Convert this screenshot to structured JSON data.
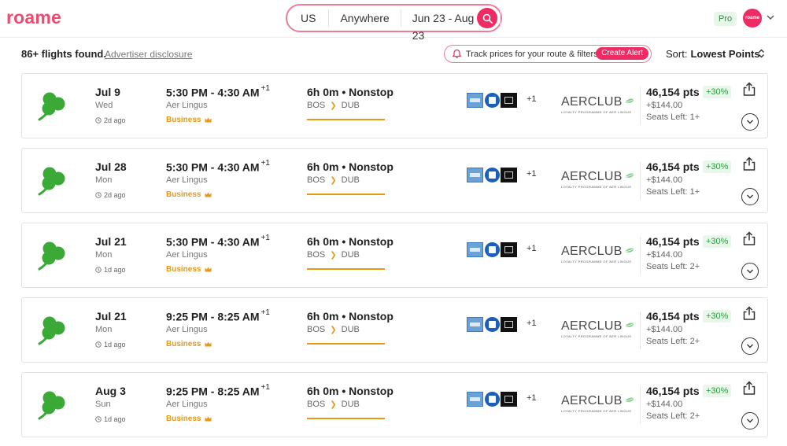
{
  "header": {
    "logo": "roame",
    "search": {
      "country": "US",
      "destination": "Anywhere",
      "dates": "Jun 23 - Aug 23"
    },
    "pro_label": "Pro",
    "avatar_label": "roame"
  },
  "subbar": {
    "found": "86+ flights found.",
    "disclosure": "Advertiser disclosure",
    "track_label": "Track prices for your route & filters",
    "create_alert": "Create Alert",
    "sort_label": "Sort:",
    "sort_value": "Lowest Points"
  },
  "colors": {
    "brand": "#ef2b63",
    "accent_orange": "#e59a1a",
    "clover_green": "#3aa935",
    "positive_green": "#2e9b42"
  },
  "program": {
    "name": "AERCLUB",
    "tagline": "LOYALTY PROGRAMME OF AER LINGUS"
  },
  "flights": [
    {
      "date": "Jul 9",
      "dow": "Wed",
      "ago": "2d ago",
      "times": "5:30 PM - 4:30 AM",
      "plus_day": "+1",
      "airline": "Aer Lingus",
      "cabin": "Business",
      "duration": "6h 0m • Nonstop",
      "from": "BOS",
      "to": "DUB",
      "extra_cards": "+1",
      "points": "46,154 pts",
      "pct": "+30%",
      "cash": "+$144.00",
      "seats": "Seats Left: 1+"
    },
    {
      "date": "Jul 28",
      "dow": "Mon",
      "ago": "2d ago",
      "times": "5:30 PM - 4:30 AM",
      "plus_day": "+1",
      "airline": "Aer Lingus",
      "cabin": "Business",
      "duration": "6h 0m • Nonstop",
      "from": "BOS",
      "to": "DUB",
      "extra_cards": "+1",
      "points": "46,154 pts",
      "pct": "+30%",
      "cash": "+$144.00",
      "seats": "Seats Left: 1+"
    },
    {
      "date": "Jul 21",
      "dow": "Mon",
      "ago": "1d ago",
      "times": "5:30 PM - 4:30 AM",
      "plus_day": "+1",
      "airline": "Aer Lingus",
      "cabin": "Business",
      "duration": "6h 0m • Nonstop",
      "from": "BOS",
      "to": "DUB",
      "extra_cards": "+1",
      "points": "46,154 pts",
      "pct": "+30%",
      "cash": "+$144.00",
      "seats": "Seats Left: 2+"
    },
    {
      "date": "Jul 21",
      "dow": "Mon",
      "ago": "1d ago",
      "times": "9:25 PM - 8:25 AM",
      "plus_day": "+1",
      "airline": "Aer Lingus",
      "cabin": "Business",
      "duration": "6h 0m • Nonstop",
      "from": "BOS",
      "to": "DUB",
      "extra_cards": "+1",
      "points": "46,154 pts",
      "pct": "+30%",
      "cash": "+$144.00",
      "seats": "Seats Left: 2+"
    },
    {
      "date": "Aug 3",
      "dow": "Sun",
      "ago": "1d ago",
      "times": "9:25 PM - 8:25 AM",
      "plus_day": "+1",
      "airline": "Aer Lingus",
      "cabin": "Business",
      "duration": "6h 0m • Nonstop",
      "from": "BOS",
      "to": "DUB",
      "extra_cards": "+1",
      "points": "46,154 pts",
      "pct": "+30%",
      "cash": "+$144.00",
      "seats": "Seats Left: 2+"
    }
  ]
}
